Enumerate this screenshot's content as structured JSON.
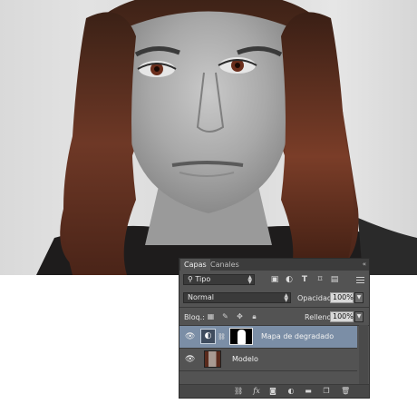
{
  "panel": {
    "tabs": [
      {
        "label": "Capas"
      },
      {
        "label": "Canales"
      }
    ],
    "collapse_glyph": "«",
    "filter": {
      "kind_label": "Tipo",
      "icons": [
        "search-icon",
        "image-filter-icon",
        "adjustment-filter-icon",
        "type-filter-icon",
        "shape-filter-icon",
        "smart-object-filter-icon"
      ]
    },
    "blend_mode": "Normal",
    "opacity_label": "Opacidad:",
    "opacity_value": "100%",
    "lock_label": "Bloq.:",
    "fill_label": "Relleno:",
    "fill_value": "100%",
    "layers": [
      {
        "name": "Mapa de degradado",
        "selected": true,
        "type": "adjustment"
      },
      {
        "name": "Modelo",
        "selected": false,
        "type": "pixel"
      }
    ],
    "footer_icons": [
      "link-icon",
      "fx-icon",
      "mask-icon",
      "new-adjustment-icon",
      "new-group-icon",
      "new-layer-icon",
      "trash-icon"
    ],
    "footer_fx_label": "fx",
    "colors": {
      "panel_bg": "#535353",
      "selected_row": "#7b8ea6",
      "tab_bar": "#3c3c3c"
    }
  }
}
